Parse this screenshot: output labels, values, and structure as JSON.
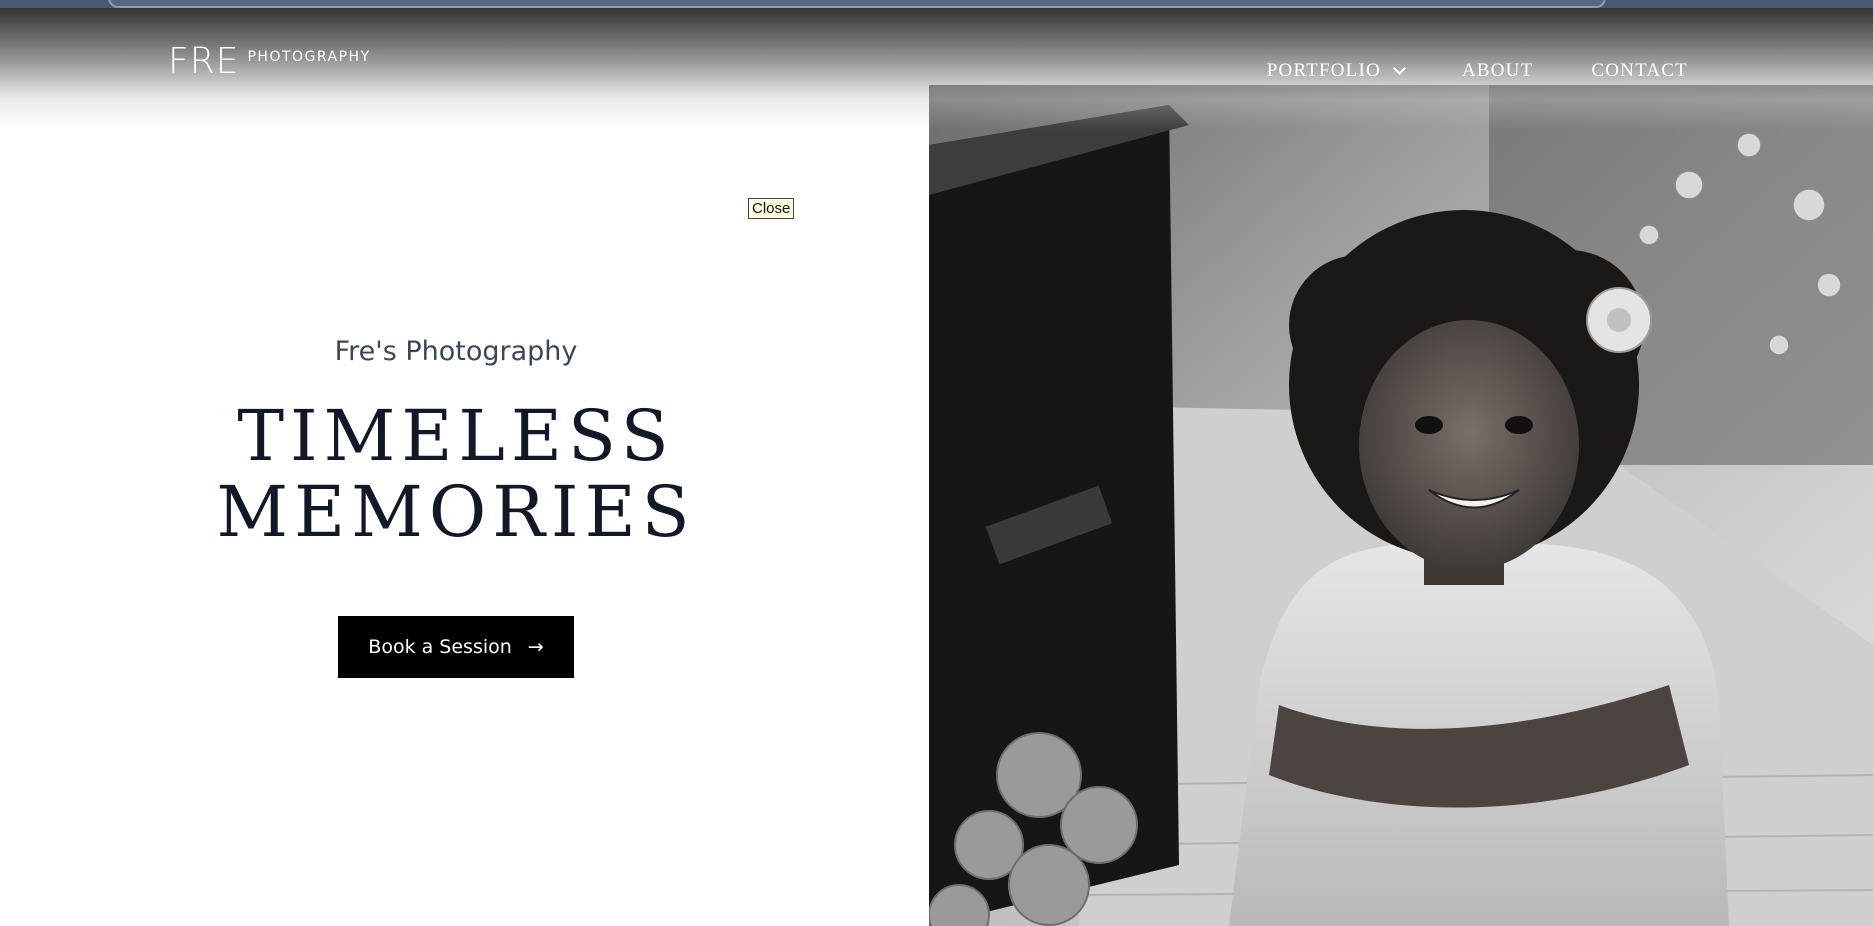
{
  "header": {
    "logo_main": "FRE",
    "logo_sub": "PHOTOGRAPHY",
    "nav": [
      {
        "label": "PORTFOLIO",
        "has_dropdown": true,
        "icon": "chevron-down-icon"
      },
      {
        "label": "ABOUT"
      },
      {
        "label": "CONTACT"
      }
    ]
  },
  "overlay": {
    "close_label": "Close"
  },
  "hero": {
    "tagline": "Fre's Photography",
    "headline_line1": "TIMELESS",
    "headline_line2": "MEMORIES",
    "cta_label": "Book a Session",
    "cta_icon": "arrow-right-icon",
    "image_description": "Black and white portrait of a smiling young girl with curly hair and a flower, arms crossed, wearing a ruffled dress on a wooden bridge"
  },
  "colors": {
    "header_gradient_top": "#2a2a2a",
    "headline": "#111827",
    "tagline": "#3b4757",
    "cta_background": "#000000",
    "cta_text": "#ffffff",
    "close_background": "#fdfde0",
    "browser_strip": "#4a5873"
  }
}
